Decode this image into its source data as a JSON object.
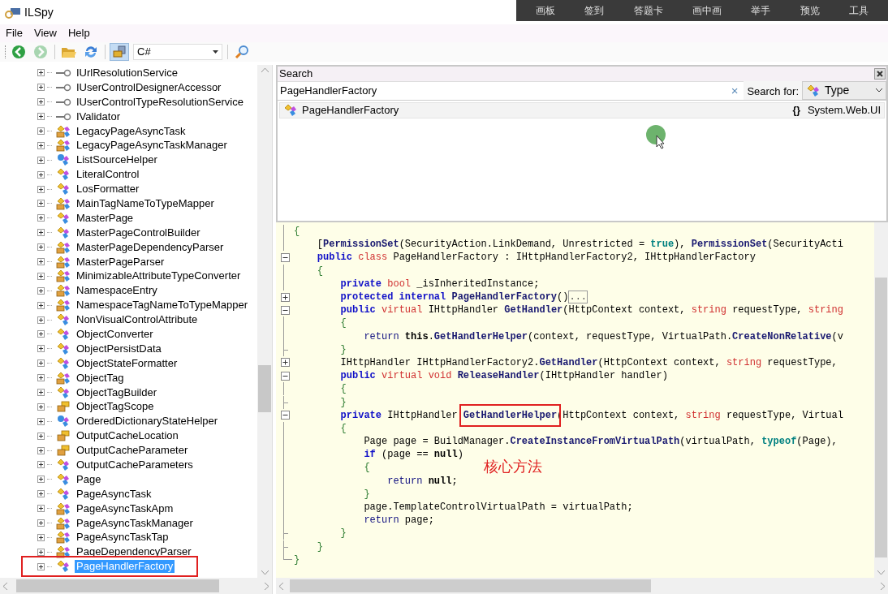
{
  "window": {
    "title": "ILSpy"
  },
  "overlay_toolbar": [
    "画板",
    "签到",
    "答题卡",
    "画中画",
    "举手",
    "预览",
    "工具"
  ],
  "menu": [
    "File",
    "View",
    "Help"
  ],
  "toolbar": {
    "buttons": [
      {
        "kind": "back",
        "disabled": false,
        "selected": false
      },
      {
        "kind": "forward",
        "disabled": true,
        "selected": false
      },
      {
        "kind": "open",
        "disabled": false,
        "selected": false
      },
      {
        "kind": "refresh",
        "disabled": false,
        "selected": false
      },
      {
        "kind": "toggle",
        "disabled": false,
        "selected": true
      }
    ],
    "language": "C#"
  },
  "tree": [
    {
      "label": "IUrlResolutionService",
      "kind": "interface",
      "selected": false,
      "boxed": false
    },
    {
      "label": "IUserControlDesignerAccessor",
      "kind": "interface",
      "selected": false,
      "boxed": false
    },
    {
      "label": "IUserControlTypeResolutionService",
      "kind": "interface",
      "selected": false,
      "boxed": false
    },
    {
      "label": "IValidator",
      "kind": "interface",
      "selected": false,
      "boxed": false
    },
    {
      "label": "LegacyPageAsyncTask",
      "kind": "internal",
      "selected": false,
      "boxed": false
    },
    {
      "label": "LegacyPageAsyncTaskManager",
      "kind": "internal",
      "selected": false,
      "boxed": false
    },
    {
      "label": "ListSourceHelper",
      "kind": "static",
      "selected": false,
      "boxed": false
    },
    {
      "label": "LiteralControl",
      "kind": "class",
      "selected": false,
      "boxed": false
    },
    {
      "label": "LosFormatter",
      "kind": "class",
      "selected": false,
      "boxed": false
    },
    {
      "label": "MainTagNameToTypeMapper",
      "kind": "internal",
      "selected": false,
      "boxed": false
    },
    {
      "label": "MasterPage",
      "kind": "class",
      "selected": false,
      "boxed": false
    },
    {
      "label": "MasterPageControlBuilder",
      "kind": "class",
      "selected": false,
      "boxed": false
    },
    {
      "label": "MasterPageDependencyParser",
      "kind": "internal",
      "selected": false,
      "boxed": false
    },
    {
      "label": "MasterPageParser",
      "kind": "internal",
      "selected": false,
      "boxed": false
    },
    {
      "label": "MinimizableAttributeTypeConverter",
      "kind": "internal",
      "selected": false,
      "boxed": false
    },
    {
      "label": "NamespaceEntry",
      "kind": "internal",
      "selected": false,
      "boxed": false
    },
    {
      "label": "NamespaceTagNameToTypeMapper",
      "kind": "internal",
      "selected": false,
      "boxed": false
    },
    {
      "label": "NonVisualControlAttribute",
      "kind": "class",
      "selected": false,
      "boxed": false
    },
    {
      "label": "ObjectConverter",
      "kind": "class",
      "selected": false,
      "boxed": false
    },
    {
      "label": "ObjectPersistData",
      "kind": "class",
      "selected": false,
      "boxed": false
    },
    {
      "label": "ObjectStateFormatter",
      "kind": "class",
      "selected": false,
      "boxed": false
    },
    {
      "label": "ObjectTag",
      "kind": "internal",
      "selected": false,
      "boxed": false
    },
    {
      "label": "ObjectTagBuilder",
      "kind": "class",
      "selected": false,
      "boxed": false
    },
    {
      "label": "ObjectTagScope",
      "kind": "enum",
      "selected": false,
      "boxed": false
    },
    {
      "label": "OrderedDictionaryStateHelper",
      "kind": "static",
      "selected": false,
      "boxed": false
    },
    {
      "label": "OutputCacheLocation",
      "kind": "enum",
      "selected": false,
      "boxed": false
    },
    {
      "label": "OutputCacheParameter",
      "kind": "enum",
      "selected": false,
      "boxed": false
    },
    {
      "label": "OutputCacheParameters",
      "kind": "class",
      "selected": false,
      "boxed": false
    },
    {
      "label": "Page",
      "kind": "class",
      "selected": false,
      "boxed": false
    },
    {
      "label": "PageAsyncTask",
      "kind": "class",
      "selected": false,
      "boxed": false
    },
    {
      "label": "PageAsyncTaskApm",
      "kind": "internal",
      "selected": false,
      "boxed": false
    },
    {
      "label": "PageAsyncTaskManager",
      "kind": "internal",
      "selected": false,
      "boxed": false
    },
    {
      "label": "PageAsyncTaskTap",
      "kind": "internal",
      "selected": false,
      "boxed": false
    },
    {
      "label": "PageDependencyParser",
      "kind": "internal",
      "selected": false,
      "boxed": false
    },
    {
      "label": "PageHandlerFactory",
      "kind": "class",
      "selected": true,
      "boxed": true
    }
  ],
  "search": {
    "title": "Search",
    "value": "PageHandlerFactory",
    "clear": "×",
    "search_for_label": "Search for:",
    "search_for": "Type",
    "results": [
      {
        "name": "PageHandlerFactory",
        "namespace_icon": "{}",
        "namespace": "System.Web.UI",
        "selected": true
      }
    ]
  },
  "code": [
    {
      "kind": "line",
      "tokens": [
        {
          "kind": "punct",
          "text": "{"
        }
      ]
    },
    {
      "kind": "line",
      "tokens": [
        {
          "kind": "plain",
          "text": "    ["
        },
        {
          "kind": "member",
          "text": "PermissionSet"
        },
        {
          "kind": "plain",
          "text": "(SecurityAction.LinkDemand, Unrestricted = "
        },
        {
          "kind": "literal",
          "text": "true"
        },
        {
          "kind": "plain",
          "text": "), "
        },
        {
          "kind": "member",
          "text": "PermissionSet"
        },
        {
          "kind": "plain",
          "text": "(SecurityActi"
        }
      ]
    },
    {
      "kind": "collapse",
      "tokens": [
        {
          "kind": "keyword",
          "text": "    public"
        },
        {
          "kind": "modifier",
          "text": " class"
        },
        {
          "kind": "plain",
          "text": " PageHandlerFactory : IHttpHandlerFactory2, IHttpHandlerFactory"
        }
      ]
    },
    {
      "kind": "line",
      "tokens": [
        {
          "kind": "punct",
          "text": "    {"
        }
      ]
    },
    {
      "kind": "line",
      "tokens": [
        {
          "kind": "keyword",
          "text": "        private"
        },
        {
          "kind": "modifier",
          "text": " bool"
        },
        {
          "kind": "plain",
          "text": " _isInheritedInstance;"
        }
      ]
    },
    {
      "kind": "expand",
      "tokens": [
        {
          "kind": "keyword",
          "text": "        protected internal"
        },
        {
          "kind": "member",
          "text": " PageHandlerFactory"
        },
        {
          "kind": "plain",
          "text": "()"
        },
        {
          "kind": "folded",
          "text": "..."
        }
      ]
    },
    {
      "kind": "collapse",
      "tokens": [
        {
          "kind": "keyword",
          "text": "        public"
        },
        {
          "kind": "modifier",
          "text": " virtual"
        },
        {
          "kind": "plain",
          "text": " IHttpHandler "
        },
        {
          "kind": "member",
          "text": "GetHandler"
        },
        {
          "kind": "plain",
          "text": "(HttpContext context, "
        },
        {
          "kind": "modifier",
          "text": "string"
        },
        {
          "kind": "plain",
          "text": " requestType, "
        },
        {
          "kind": "modifier",
          "text": "string"
        }
      ]
    },
    {
      "kind": "line",
      "tokens": [
        {
          "kind": "punct",
          "text": "        {"
        }
      ]
    },
    {
      "kind": "line",
      "tokens": [
        {
          "kind": "flow",
          "text": "            return"
        },
        {
          "kind": "strong",
          "text": " this"
        },
        {
          "kind": "plain",
          "text": "."
        },
        {
          "kind": "member",
          "text": "GetHandlerHelper"
        },
        {
          "kind": "plain",
          "text": "(context, requestType, VirtualPath."
        },
        {
          "kind": "member",
          "text": "CreateNonRelative"
        },
        {
          "kind": "plain",
          "text": "(v"
        }
      ]
    },
    {
      "kind": "end",
      "tokens": [
        {
          "kind": "punct",
          "text": "        }"
        }
      ]
    },
    {
      "kind": "expand",
      "tokens": [
        {
          "kind": "plain",
          "text": "        IHttpHandler IHttpHandlerFactory2."
        },
        {
          "kind": "member",
          "text": "GetHandler"
        },
        {
          "kind": "plain",
          "text": "(HttpContext context, "
        },
        {
          "kind": "modifier",
          "text": "string"
        },
        {
          "kind": "plain",
          "text": " requestType,"
        }
      ]
    },
    {
      "kind": "collapse",
      "tokens": [
        {
          "kind": "keyword",
          "text": "        public"
        },
        {
          "kind": "modifier",
          "text": " virtual void"
        },
        {
          "kind": "member",
          "text": " ReleaseHandler"
        },
        {
          "kind": "plain",
          "text": "(IHttpHandler handler)"
        }
      ]
    },
    {
      "kind": "line",
      "tokens": [
        {
          "kind": "punct",
          "text": "        {"
        }
      ]
    },
    {
      "kind": "end",
      "tokens": [
        {
          "kind": "punct",
          "text": "        }"
        }
      ]
    },
    {
      "kind": "collapse",
      "tokens": [
        {
          "kind": "keyword",
          "text": "        private"
        },
        {
          "kind": "plain",
          "text": " IHttpHandler "
        },
        {
          "kind": "boxed",
          "text": "GetHandlerHelper"
        },
        {
          "kind": "plain",
          "text": "(HttpContext context, "
        },
        {
          "kind": "modifier",
          "text": "string"
        },
        {
          "kind": "plain",
          "text": " requestType, Virtual"
        }
      ]
    },
    {
      "kind": "line",
      "tokens": [
        {
          "kind": "punct",
          "text": "        {"
        }
      ]
    },
    {
      "kind": "line",
      "tokens": [
        {
          "kind": "plain",
          "text": "            Page page = BuildManager."
        },
        {
          "kind": "member",
          "text": "CreateInstanceFromVirtualPath"
        },
        {
          "kind": "plain",
          "text": "(virtualPath, "
        },
        {
          "kind": "literal",
          "text": "typeof"
        },
        {
          "kind": "plain",
          "text": "(Page),"
        }
      ]
    },
    {
      "kind": "line",
      "tokens": [
        {
          "kind": "keyword",
          "text": "            if"
        },
        {
          "kind": "plain",
          "text": " (page == "
        },
        {
          "kind": "strong",
          "text": "null"
        },
        {
          "kind": "plain",
          "text": ")"
        }
      ]
    },
    {
      "kind": "line",
      "tokens": [
        {
          "kind": "punct",
          "text": "            {"
        }
      ]
    },
    {
      "kind": "line",
      "tokens": [
        {
          "kind": "flow",
          "text": "                return"
        },
        {
          "kind": "strong",
          "text": " null"
        },
        {
          "kind": "plain",
          "text": ";"
        }
      ]
    },
    {
      "kind": "line",
      "tokens": [
        {
          "kind": "punct",
          "text": "            }"
        }
      ]
    },
    {
      "kind": "line",
      "tokens": [
        {
          "kind": "plain",
          "text": "            page.TemplateControlVirtualPath = virtualPath;"
        }
      ]
    },
    {
      "kind": "line",
      "tokens": [
        {
          "kind": "flow",
          "text": "            return"
        },
        {
          "kind": "plain",
          "text": " page;"
        }
      ]
    },
    {
      "kind": "end",
      "tokens": [
        {
          "kind": "punct",
          "text": "        }"
        }
      ]
    },
    {
      "kind": "end",
      "tokens": [
        {
          "kind": "punct",
          "text": "    }"
        }
      ]
    },
    {
      "kind": "last",
      "tokens": [
        {
          "kind": "punct",
          "text": "}"
        }
      ]
    }
  ],
  "annotation": "核心方法"
}
